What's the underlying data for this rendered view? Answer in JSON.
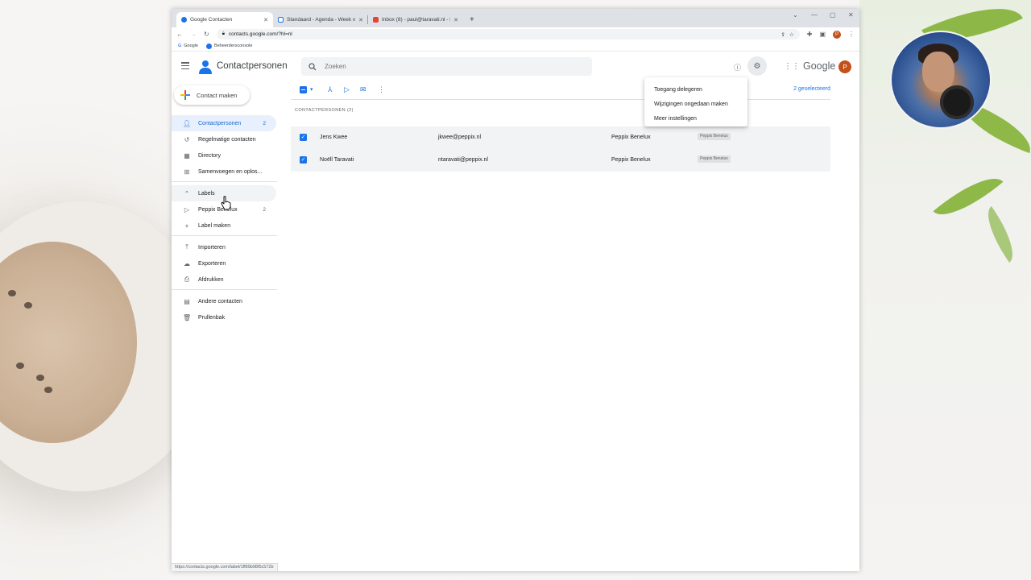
{
  "browser": {
    "tabs": [
      {
        "title": "Google Contacten",
        "active": true
      },
      {
        "title": "Standaard - Agenda - Week van",
        "active": false
      },
      {
        "title": "Inbox (8) - paul@taravati.nl - M...",
        "active": false
      }
    ],
    "new_tab": "+",
    "url": "contacts.google.com/?hl=nl",
    "bookmarks": [
      "Google",
      "Beheerdersconsole"
    ],
    "status_url": "https://contacts.google.com/label/1ff89b98f5c572b"
  },
  "header": {
    "app_title": "Contactpersonen",
    "search_placeholder": "Zoeken",
    "google_word": "Google",
    "avatar_letter": "P"
  },
  "sidebar": {
    "create_label": "Contact maken",
    "items": [
      {
        "label": "Contactpersonen",
        "count": "2",
        "icon": "person-icon"
      },
      {
        "label": "Regelmatige contacten",
        "count": "",
        "icon": "history-icon"
      },
      {
        "label": "Directory",
        "count": "",
        "icon": "domain-icon"
      },
      {
        "label": "Samenvoegen en oplos...",
        "count": "",
        "icon": "merge-icon"
      }
    ],
    "labels_header": "Labels",
    "label_items": [
      {
        "label": "Peppix Benelux",
        "count": "2"
      }
    ],
    "create_label_item": "Label maken",
    "tools": [
      {
        "label": "Importeren",
        "icon": "upload-icon"
      },
      {
        "label": "Exporteren",
        "icon": "cloud-download-icon"
      },
      {
        "label": "Afdrukken",
        "icon": "print-icon"
      }
    ],
    "other": [
      {
        "label": "Andere contacten",
        "icon": "archive-icon"
      },
      {
        "label": "Prullenbak",
        "icon": "trash-icon"
      }
    ]
  },
  "main": {
    "selected_count": "2 geselecteerd",
    "section_label": "CONTACTPERSONEN (2)",
    "contacts": [
      {
        "name": "Jens Kwee",
        "email": "jkwee@peppix.nl",
        "company": "Peppix Benelux",
        "label": "Peppix Benelux"
      },
      {
        "name": "Noëll Taravati",
        "email": "ntaravati@peppix.nl",
        "company": "Peppix Benelux",
        "label": "Peppix Benelux"
      }
    ]
  },
  "settings_menu": {
    "items": [
      "Toegang delegeren",
      "Wijzigingen ongedaan maken",
      "Meer instellingen"
    ]
  },
  "colors": {
    "accent": "#1a73e8",
    "active_nav_bg": "#e8f0fe",
    "avatar": "#c4501a"
  }
}
